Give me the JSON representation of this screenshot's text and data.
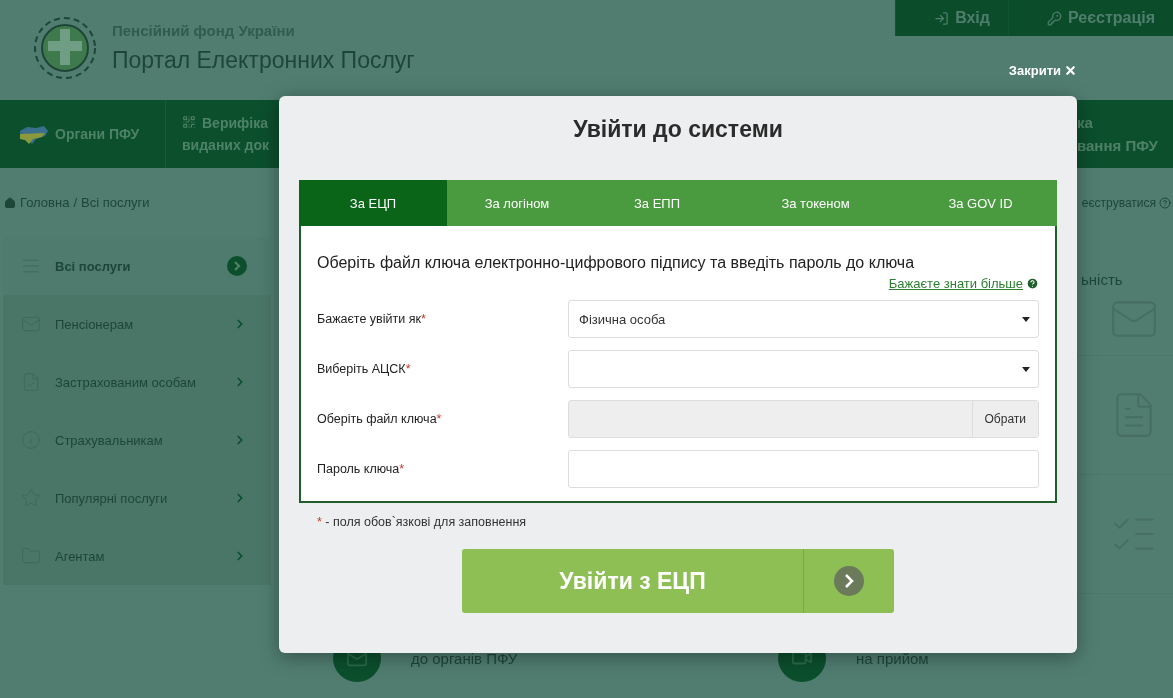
{
  "header": {
    "org_name": "Пенсійний фонд України",
    "portal_title": "Портал Електронних Послуг",
    "auth_links": [
      {
        "kind": "login",
        "label": "Вхід"
      },
      {
        "kind": "register",
        "label": "Реєстрація"
      }
    ]
  },
  "nav": {
    "items": [
      {
        "kind": "map",
        "lines": [
          "Органи ПФУ"
        ]
      },
      {
        "kind": "qr",
        "lines": [
          "Верифіка",
          "виданих док"
        ]
      }
    ],
    "right_item": {
      "lines": [
        "ка",
        "вання ПФУ"
      ]
    }
  },
  "breadcrumb": {
    "items": [
      "Головна",
      "Всі послуги"
    ],
    "separator": "/",
    "right_link": "еєструватися"
  },
  "sidebar": {
    "items": [
      {
        "label": "Всі послуги",
        "selected": true
      },
      {
        "label": "Пенсіонерам",
        "selected": false
      },
      {
        "label": "Застрахованим особам",
        "selected": false
      },
      {
        "label": "Страхувальникам",
        "selected": false
      },
      {
        "label": "Популярні послуги",
        "selected": false
      },
      {
        "label": "Агентам",
        "selected": false
      }
    ]
  },
  "background_cards": {
    "right_text": "ьність",
    "bottom": [
      "до органів ПФУ",
      "на прийом"
    ]
  },
  "modal": {
    "close_label": "Закрити",
    "title": "Увійти до системи",
    "tabs": [
      {
        "label": "За ЕЦП",
        "selected": true
      },
      {
        "label": "За логіном",
        "selected": false
      },
      {
        "label": "За ЕПП",
        "selected": false
      },
      {
        "label": "За токеном",
        "selected": false
      },
      {
        "label": "За GOV ID",
        "selected": false
      }
    ],
    "heading": "Оберіть файл ключа електронно-цифрового підпису та введіть пароль до ключа",
    "more_link": "Бажаєте знати більше",
    "fields": [
      {
        "kind": "select",
        "label": "Бажаєте увійти як",
        "required_mark": "*",
        "value": "Фізична особа"
      },
      {
        "kind": "select",
        "label": "Виберіть АЦСК",
        "required_mark": "*"
      },
      {
        "kind": "file",
        "label": "Оберіть файл ключа",
        "required_mark": "*",
        "button": "Обрати"
      },
      {
        "kind": "password",
        "label": "Пароль ключа",
        "required_mark": "*"
      }
    ],
    "required_note": {
      "mark": "*",
      "text": "- поля обов`язкові для заповнення"
    },
    "submit": "Увійти з ЕЦП"
  }
}
